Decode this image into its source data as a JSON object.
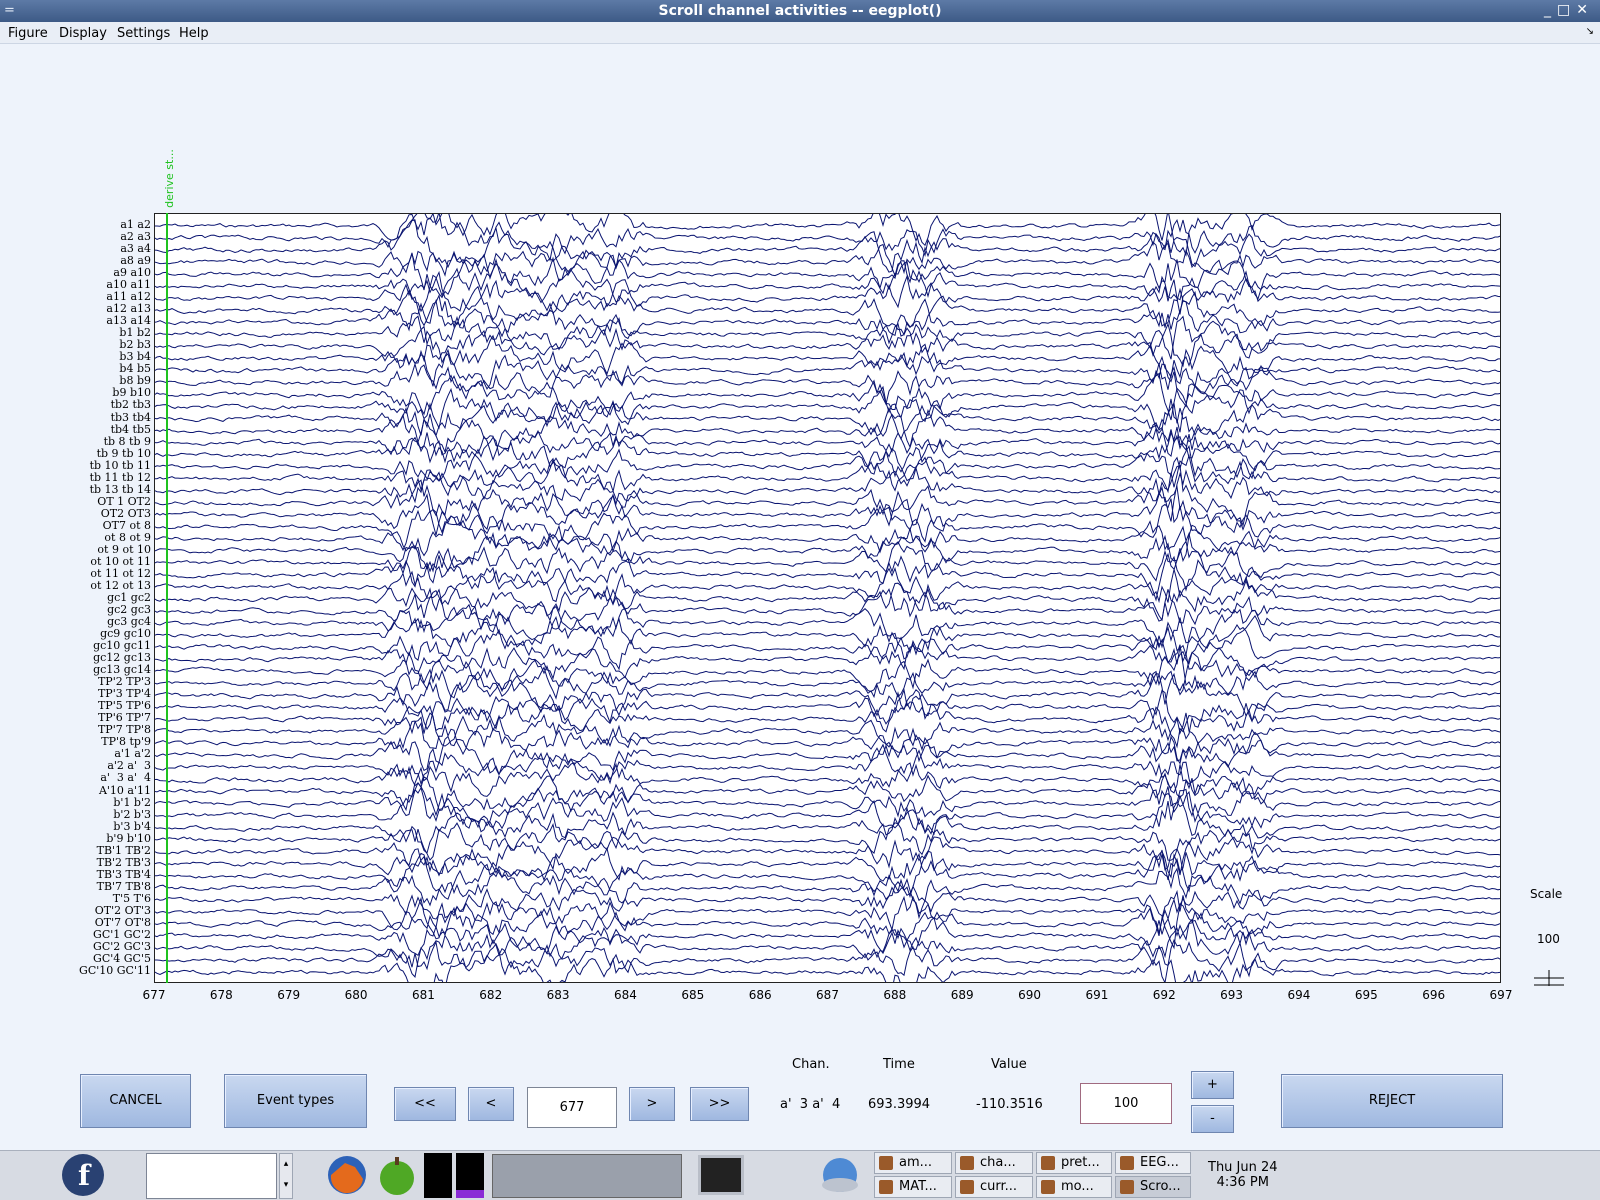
{
  "window": {
    "title": "Scroll channel activities -- eegplot()"
  },
  "menu": [
    "Figure",
    "Display",
    "Settings",
    "Help"
  ],
  "event": {
    "label": "derive st..."
  },
  "channels": [
    "a1 a2",
    "a2 a3",
    "a3 a4",
    "a8 a9",
    "a9 a10",
    "a10 a11",
    "a11 a12",
    "a12 a13",
    "a13 a14",
    "b1 b2",
    "b2 b3",
    "b3 b4",
    "b4 b5",
    "b8 b9",
    "b9 b10",
    "tb2 tb3",
    "tb3 tb4",
    "tb4 tb5",
    "tb 8 tb 9",
    "tb 9 tb 10",
    "tb 10 tb 11",
    "tb 11 tb 12",
    "tb 13 tb 14",
    "OT 1 OT2",
    "OT2 OT3",
    "OT7 ot 8",
    "ot 8 ot 9",
    "ot 9 ot 10",
    "ot 10 ot 11",
    "ot 11 ot 12",
    "ot 12 ot 13",
    "gc1 gc2",
    "gc2 gc3",
    "gc3 gc4",
    "gc9 gc10",
    "gc10 gc11",
    "gc12 gc13",
    "gc13 gc14",
    "TP'2 TP'3",
    "TP'3 TP'4",
    "TP'5 TP'6",
    "TP'6 TP'7",
    "TP'7 TP'8",
    "TP'8 tp'9",
    "a'1 a'2",
    "a'2 a'  3",
    "a'  3 a'  4",
    "A'10 a'11",
    "b'1 b'2",
    "b'2 b'3",
    "b'3 b'4",
    "b'9 b'10",
    "TB'1 TB'2",
    "TB'2 TB'3",
    "TB'3 TB'4",
    "TB'7 TB'8",
    "T'5 T'6",
    "OT'2 OT'3",
    "OT'7 OT'8",
    "GC'1 GC'2",
    "GC'2 GC'3",
    "GC'4 GC'5",
    "GC'10 GC'11"
  ],
  "x_ticks": [
    "677",
    "678",
    "679",
    "680",
    "681",
    "682",
    "683",
    "684",
    "685",
    "686",
    "687",
    "688",
    "689",
    "690",
    "691",
    "692",
    "693",
    "694",
    "695",
    "696",
    "697"
  ],
  "scale": {
    "label": "Scale",
    "value": "100"
  },
  "controls": {
    "cancel": "CANCEL",
    "event_types": "Event types",
    "first": "<<",
    "prev": "<",
    "position": "677",
    "next": ">",
    "last": ">>",
    "scale_input": "100",
    "plus": "+",
    "minus": "-",
    "reject": "REJECT"
  },
  "info": {
    "chan_label": "Chan.",
    "time_label": "Time",
    "value_label": "Value",
    "chan": "a'  3 a'  4",
    "time": "693.3994",
    "value": "-110.3516"
  },
  "taskbar": {
    "tasks_top": [
      "am...",
      "cha...",
      "pret...",
      "EEG..."
    ],
    "tasks_bottom": [
      "MAT...",
      "curr...",
      "mo...",
      "Scro..."
    ],
    "clock_day": "Thu Jun 24",
    "clock_time": "4:36 PM"
  },
  "colors": {
    "trace": "#0a1470",
    "event": "#1fc21f",
    "titlebar": "#4a6794"
  }
}
